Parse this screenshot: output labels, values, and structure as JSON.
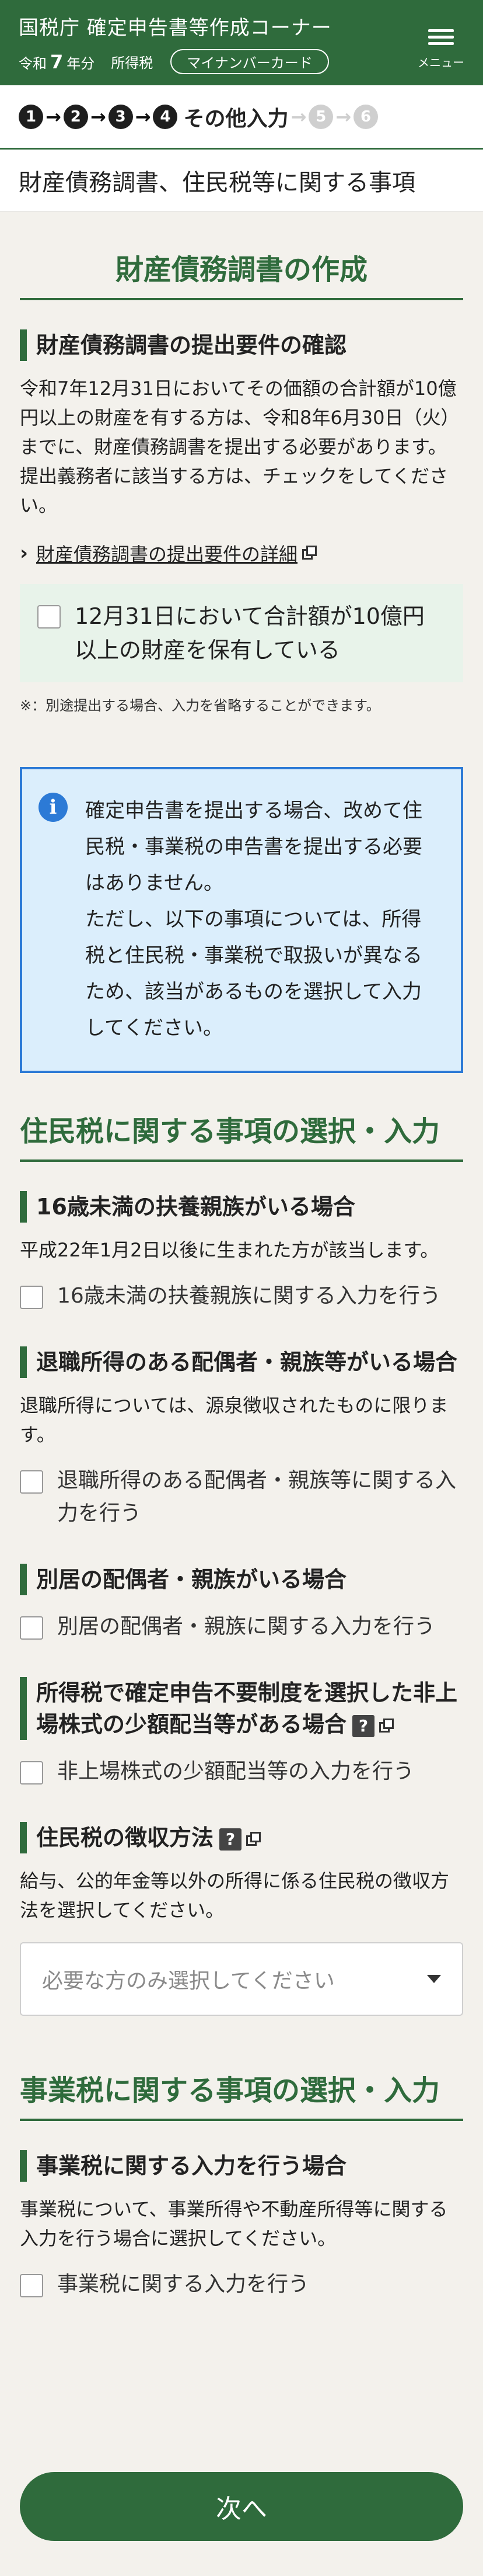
{
  "header": {
    "title": "国税庁 確定申告書等作成コーナー",
    "era_prefix": "令和",
    "year": "7",
    "year_suffix": "年分",
    "tax_type": "所得税",
    "mynumber_label": "マイナンバーカード",
    "menu_label": "メニュー"
  },
  "steps": {
    "items": [
      "1",
      "2",
      "3",
      "4",
      "5",
      "6"
    ],
    "current_label": "その他入力"
  },
  "page_title": "財産債務調書、住民税等に関する事項",
  "zaisan": {
    "section_title": "財産債務調書の作成",
    "heading": "財産債務調書の提出要件の確認",
    "text1": "令和7年12月31日においてその価額の合計額が10億円以上の財産を有する方は、令和8年6月30日（火）までに、財産債務調書を提出する必要があります。",
    "text2": "提出義務者に該当する方は、チェックをしてください。",
    "link": "財産債務調書の提出要件の詳細",
    "checkbox_label": "12月31日において合計額が10億円以上の財産を保有している",
    "note": "※：別途提出する場合、入力を省略することができます。"
  },
  "info": {
    "lines": [
      "確定申告書を提出する場合、改めて住民税・事業税の申告書を提出する必要はありません。",
      "ただし、以下の事項については、所得税と住民税・事業税で取扱いが異なるため、該当があるものを選択して入力してください。"
    ]
  },
  "juminzei": {
    "section_title": "住民税に関する事項の選択・入力",
    "fuyou": {
      "heading": "16歳未満の扶養親族がいる場合",
      "text": "平成22年1月2日以後に生まれた方が該当します。",
      "checkbox": "16歳未満の扶養親族に関する入力を行う"
    },
    "taishoku": {
      "heading": "退職所得のある配偶者・親族等がいる場合",
      "text": "退職所得については、源泉徴収されたものに限ります。",
      "checkbox": "退職所得のある配偶者・親族等に関する入力を行う"
    },
    "bekkyo": {
      "heading": "別居の配偶者・親族がいる場合",
      "checkbox": "別居の配偶者・親族に関する入力を行う"
    },
    "haito": {
      "heading": "所得税で確定申告不要制度を選択した非上場株式の少額配当等がある場合",
      "help": "?",
      "checkbox": "非上場株式の少額配当等の入力を行う"
    },
    "choshu": {
      "heading": "住民税の徴収方法",
      "help": "?",
      "text": "給与、公的年金等以外の所得に係る住民税の徴収方法を選択してください。",
      "select_placeholder": "必要な方のみ選択してください"
    }
  },
  "jigyozei": {
    "section_title": "事業税に関する事項の選択・入力",
    "heading": "事業税に関する入力を行う場合",
    "text": "事業税について、事業所得や不動産所得等に関する入力を行う場合に選択してください。",
    "checkbox": "事業税に関する入力を行う"
  },
  "next_label": "次へ",
  "colors": {
    "brand_green": "#2f6b3c",
    "info_blue": "#2c7ad6",
    "info_bg": "#dbeefc",
    "check_area_bg": "#e8f3ea"
  }
}
